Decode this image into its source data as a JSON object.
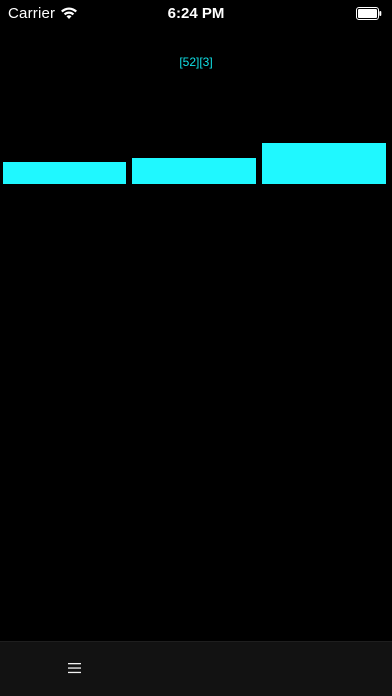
{
  "status_bar": {
    "carrier": "Carrier",
    "time": "6:24 PM",
    "icons": [
      "wifi-icon",
      "battery-icon"
    ]
  },
  "header": {
    "label": "[52][3]"
  },
  "toolbar": {
    "icons": [
      "menu-icon"
    ]
  },
  "colors": {
    "background": "#000000",
    "accent": "#1ff8ff",
    "label": "#11e0e6",
    "toolbar": "#121212"
  },
  "bars": {
    "count": 3
  }
}
